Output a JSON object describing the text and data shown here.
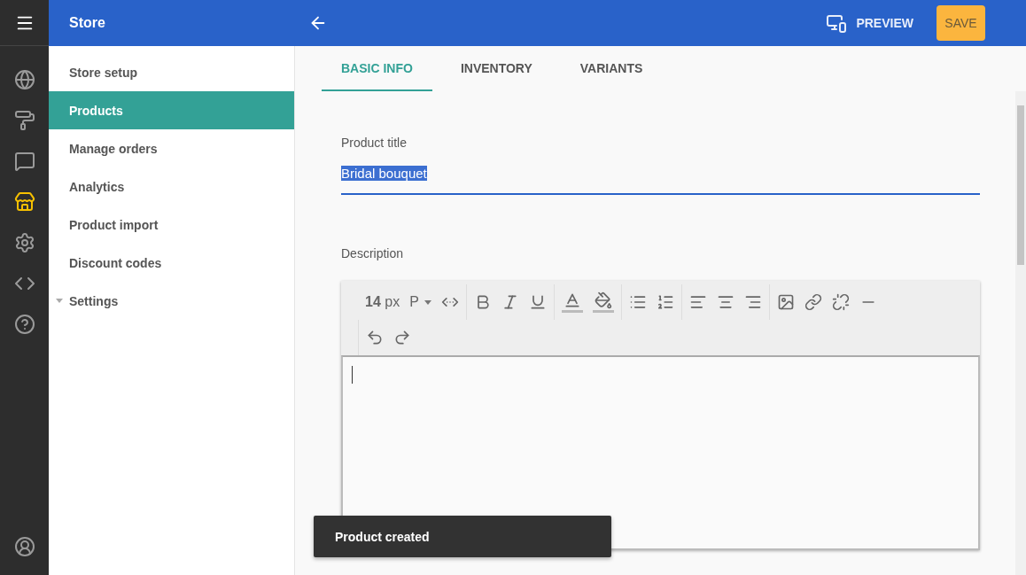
{
  "header": {
    "title": "Store",
    "preview": "PREVIEW",
    "save": "SAVE"
  },
  "rail": [
    {
      "kind": "globe",
      "selected": false
    },
    {
      "kind": "roller",
      "selected": false
    },
    {
      "kind": "feedback",
      "selected": false
    },
    {
      "kind": "store",
      "selected": true
    },
    {
      "kind": "settings",
      "selected": false
    },
    {
      "kind": "code",
      "selected": false
    },
    {
      "kind": "help",
      "selected": false
    }
  ],
  "nav": [
    {
      "label": "Store setup",
      "selected": false,
      "kind": "item"
    },
    {
      "label": "Products",
      "selected": true,
      "kind": "item"
    },
    {
      "label": "Manage orders",
      "selected": false,
      "kind": "item"
    },
    {
      "label": "Analytics",
      "selected": false,
      "kind": "item"
    },
    {
      "label": "Product import",
      "selected": false,
      "kind": "item"
    },
    {
      "label": "Discount codes",
      "selected": false,
      "kind": "item"
    },
    {
      "label": "Settings",
      "selected": false,
      "kind": "group",
      "expanded": false
    }
  ],
  "tabs": [
    {
      "label": "BASIC INFO",
      "selected": true
    },
    {
      "label": "INVENTORY",
      "selected": false
    },
    {
      "label": "VARIANTS",
      "selected": false
    }
  ],
  "product_title": {
    "label": "Product title",
    "value": "Bridal bouquet",
    "text_selected": true
  },
  "description": {
    "label": "Description",
    "font_size": "14",
    "font_unit": "px",
    "block_format": "P"
  },
  "toast": "Product created"
}
